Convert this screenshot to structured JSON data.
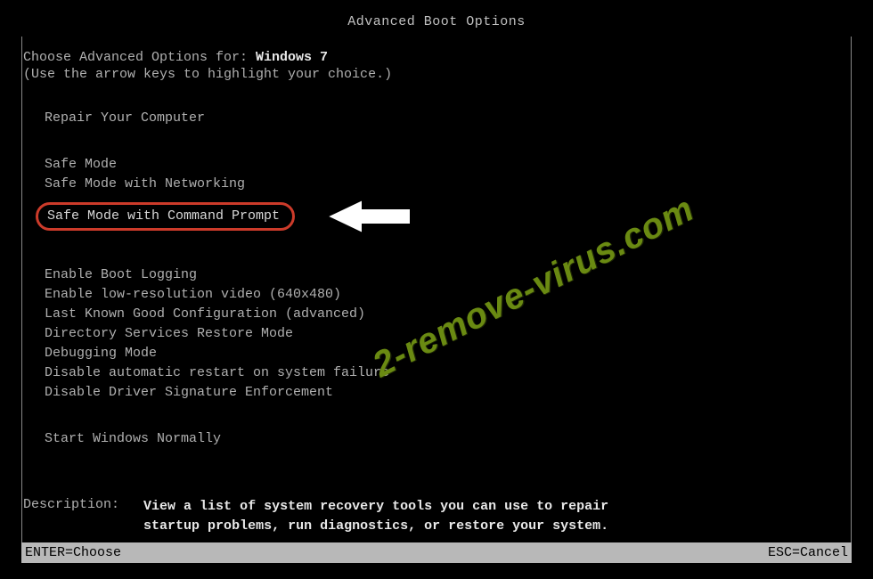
{
  "title": "Advanced Boot Options",
  "choose_prefix": "Choose Advanced Options for: ",
  "os_name": "Windows 7",
  "hint": "(Use the arrow keys to highlight your choice.)",
  "group1": {
    "items": [
      "Repair Your Computer"
    ]
  },
  "group2": {
    "items": [
      "Safe Mode",
      "Safe Mode with Networking",
      "Safe Mode with Command Prompt"
    ],
    "highlighted_index": 2
  },
  "group3": {
    "items": [
      "Enable Boot Logging",
      "Enable low-resolution video (640x480)",
      "Last Known Good Configuration (advanced)",
      "Directory Services Restore Mode",
      "Debugging Mode",
      "Disable automatic restart on system failure",
      "Disable Driver Signature Enforcement"
    ]
  },
  "group4": {
    "items": [
      "Start Windows Normally"
    ]
  },
  "description": {
    "label": "Description:",
    "text": "View a list of system recovery tools you can use to repair\nstartup problems, run diagnostics, or restore your system."
  },
  "footer": {
    "left": "ENTER=Choose",
    "right": "ESC=Cancel"
  },
  "watermark": "2-remove-virus.com",
  "annotation": "arrow-pointer"
}
